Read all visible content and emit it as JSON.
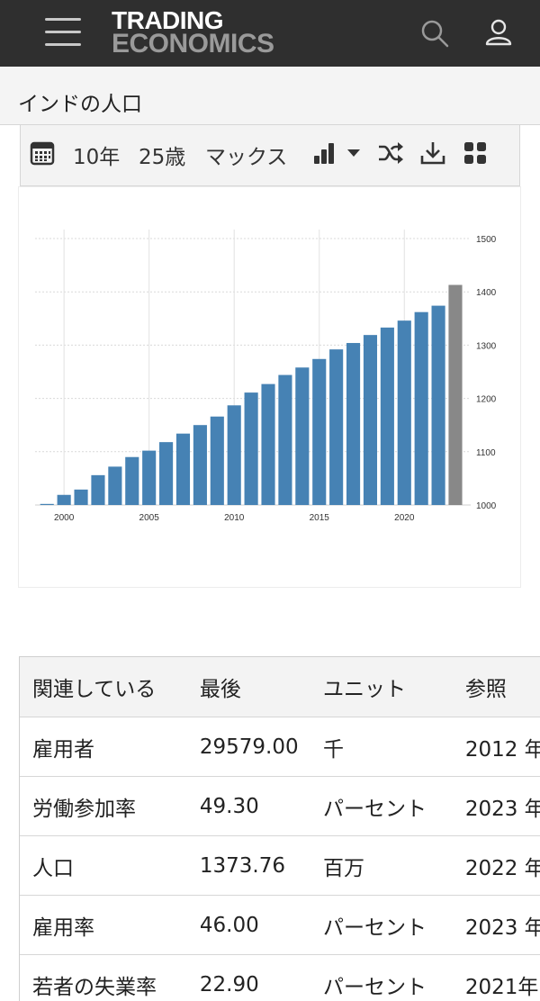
{
  "header": {
    "logo_line1": "TRADING",
    "logo_line2": "ECONOMICS",
    "menu_icon": "hamburger-icon",
    "search_icon": "search-icon",
    "user_icon": "user-icon"
  },
  "page": {
    "title": "インドの人口"
  },
  "toolbar": {
    "range_10y": "10年",
    "range_25y": "25歳",
    "range_max": "マックス",
    "icons": [
      "calendar-icon",
      "bar-chart-icon",
      "shuffle-icon",
      "download-icon",
      "grid-icon"
    ]
  },
  "colors": {
    "bar": "#4682b4",
    "forecast_bar": "#888888",
    "header_bg": "#2f2f2f"
  },
  "chart_data": {
    "type": "bar",
    "x": [
      1999,
      2000,
      2001,
      2002,
      2003,
      2004,
      2005,
      2006,
      2007,
      2008,
      2009,
      2010,
      2011,
      2012,
      2013,
      2014,
      2015,
      2016,
      2017,
      2018,
      2019,
      2020,
      2021,
      2022,
      2023
    ],
    "values": [
      1002,
      1019,
      1029,
      1056,
      1072,
      1090,
      1102,
      1118,
      1134,
      1150,
      1166,
      1187,
      1211,
      1227,
      1244,
      1258,
      1274,
      1292,
      1304,
      1319,
      1333,
      1346,
      1362,
      1374,
      1413
    ],
    "highlight_last": true,
    "xticks": [
      2000,
      2005,
      2010,
      2015,
      2020
    ],
    "yticks": [
      1000,
      1100,
      1200,
      1300,
      1400,
      1500
    ],
    "ylim": [
      1000,
      1500
    ],
    "grid": true,
    "title": "",
    "xlabel": "",
    "ylabel": ""
  },
  "related_table": {
    "headers": [
      "関連している",
      "最後",
      "ユニット",
      "参照"
    ],
    "rows": [
      [
        "雇用者",
        "29579.00",
        "千",
        "2012 年"
      ],
      [
        "労働参加率",
        "49.30",
        "パーセント",
        "2023 年"
      ],
      [
        "人口",
        "1373.76",
        "百万",
        "2022 年"
      ],
      [
        "雇用率",
        "46.00",
        "パーセント",
        "2023 年"
      ],
      [
        "若者の失業率",
        "22.90",
        "パーセント",
        "2021年"
      ]
    ]
  }
}
